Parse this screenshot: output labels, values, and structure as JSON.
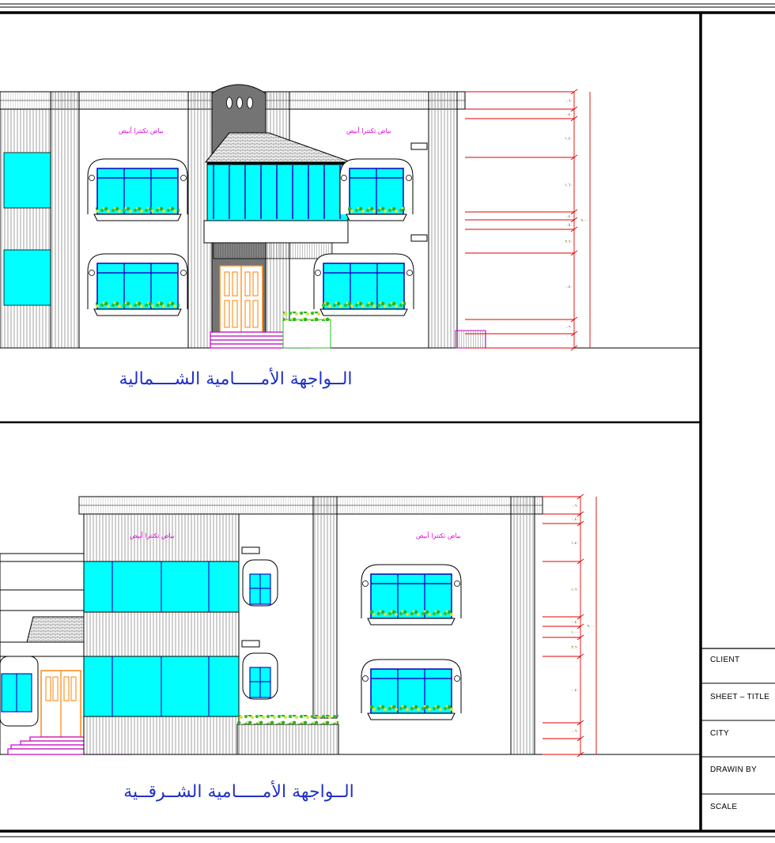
{
  "title_block": {
    "client_label": "CLIENT",
    "sheet_title_label": "SHEET – TITLE",
    "city_label": "CITY",
    "drawn_by_label": "DRAWIN BY",
    "scale_label": "SCALE"
  },
  "elevations": [
    {
      "title": "الــواجهة الأمـــــامية الشــــمالية",
      "wall_notes": [
        "بياض تكتترا أبيض",
        "بياض تكتترا أبيض"
      ],
      "dimensions": [
        "٠.٦٠",
        "٠.٤٠",
        "١.٤٠",
        "١.٦٠",
        "٠.٤٠",
        "٠.٥٠",
        "٢.٦٠",
        "٠.٤٠",
        "٠.٦٠",
        "٩.٠٠"
      ]
    },
    {
      "title": "الــواجهة الأمـــــامية الشــرقــية",
      "wall_notes": [
        "بياض تكتترا أبيض",
        "بياض تكتترا أبيض"
      ],
      "dimensions": [
        "٠.٦٠",
        "٠.٤٠",
        "١.٤٠",
        "١.٦٠",
        "٠.٤٠",
        "١.٠٠",
        "٢.٦٠",
        "٠.٤٠",
        "٠.٦٠",
        "٩.٠٠"
      ]
    }
  ],
  "colors": {
    "glass": "#00ffff",
    "mullion": "#1010c0",
    "dimension": "#e00000",
    "door": "#ff8000",
    "steps": "#c000c0",
    "plants": "#20c020",
    "title_text": "#2030c8"
  }
}
